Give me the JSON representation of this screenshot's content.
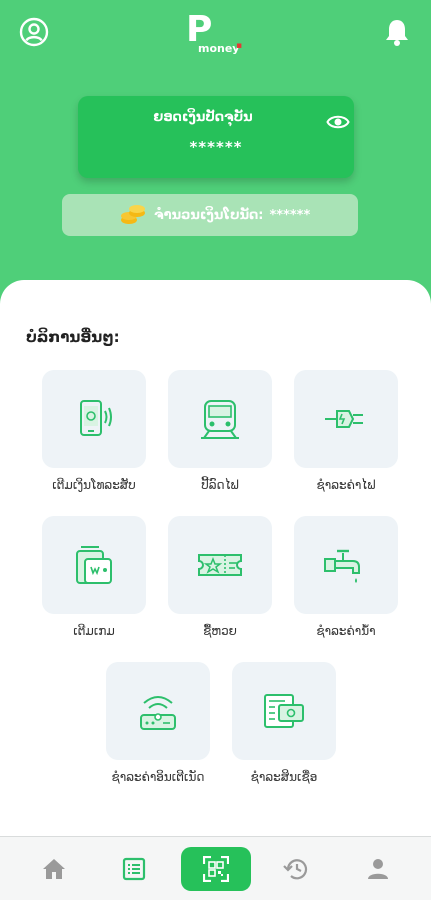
{
  "header": {
    "logo_letter": "P",
    "logo_text": "money",
    "profile_icon": "profile-icon",
    "bell_icon": "bell-icon"
  },
  "balance": {
    "label": "ຍອດເງິນປັດຈຸບັນ",
    "value": "******",
    "eye_icon": "eye-icon"
  },
  "bonus": {
    "label": "ຈໍານວນເງິນໂບນັດ:",
    "value": "******",
    "icon": "coin-icon"
  },
  "services": {
    "title": "ບໍລິການອື່ນໆ:",
    "items": [
      {
        "label": "ເຕີມເງິນໂທລະສັບ",
        "icon": "phone-topup-icon"
      },
      {
        "label": "ປີ້ລົດໄຟ",
        "icon": "train-icon"
      },
      {
        "label": "ຊໍາລະຄ່າໄຟ",
        "icon": "electric-plug-icon"
      },
      {
        "label": "ເຕີມເກມ",
        "icon": "game-topup-icon"
      },
      {
        "label": "ຊື້ຫວຍ",
        "icon": "lottery-ticket-icon"
      },
      {
        "label": "ຊໍາລະຄ່ານໍ້າ",
        "icon": "water-tap-icon"
      },
      {
        "label": "ຊໍາລະຄ່າອິນເຕີເນັດ",
        "icon": "internet-router-icon"
      },
      {
        "label": "ຊໍາລະສິນເຊື່ອ",
        "icon": "loan-payment-icon"
      }
    ]
  },
  "bottom_nav": {
    "items": [
      "home-icon",
      "list-icon",
      "qr-scan-icon",
      "history-icon",
      "user-icon"
    ],
    "active": "qr-scan-icon"
  },
  "colors": {
    "header_green": "#4fcf79",
    "card_green": "#26c15a",
    "icon_green": "#2dbf6c",
    "tile_bg": "#eef3f7"
  }
}
